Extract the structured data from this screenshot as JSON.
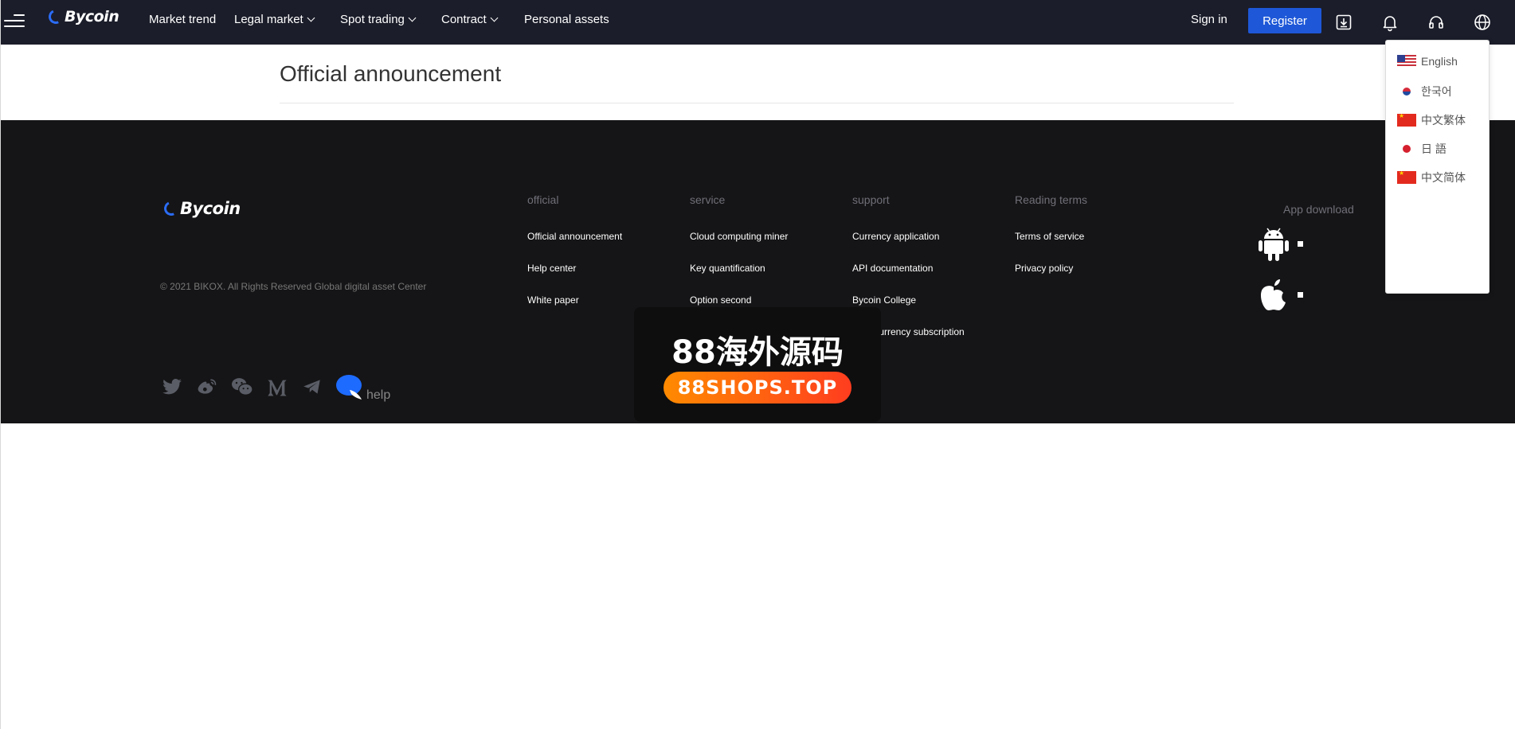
{
  "header": {
    "logo_text": "Bycoin",
    "nav": [
      {
        "label": "Market trend"
      },
      {
        "label": "Legal market"
      },
      {
        "label": "Spot trading"
      },
      {
        "label": "Contract"
      },
      {
        "label": "Personal assets"
      }
    ],
    "sign_in": "Sign in",
    "register": "Register",
    "icons": [
      "download-icon",
      "bell-icon",
      "headset-icon",
      "globe-icon"
    ]
  },
  "main": {
    "title": "Official announcement"
  },
  "footer": {
    "logo_text": "Bycoin",
    "copyright": "© 2021 BIKOX. All Rights Reserved Global digital asset Center",
    "columns": [
      {
        "heading": "official",
        "links": [
          "Official announcement",
          "Help center",
          "White paper"
        ]
      },
      {
        "heading": "service",
        "links": [
          "Cloud computing miner",
          "Key quantification",
          "Option second"
        ]
      },
      {
        "heading": "support",
        "links": [
          "Currency application",
          "API documentation",
          "Bycoin College",
          "New currency subscription"
        ]
      },
      {
        "heading": "Reading terms",
        "links": [
          "Terms of service",
          "Privacy policy"
        ]
      }
    ],
    "app_download": "App download",
    "social_icons": [
      "twitter-icon",
      "weibo-icon",
      "wechat-icon",
      "medium-icon",
      "telegram-icon"
    ],
    "help": "help"
  },
  "language_menu": {
    "items": [
      {
        "label": "English",
        "flag": "us"
      },
      {
        "label": "한국어",
        "flag": "kr"
      },
      {
        "label": "中文繁体",
        "flag": "cn"
      },
      {
        "label": "日 語",
        "flag": "jp"
      },
      {
        "label": "中文简体",
        "flag": "cn"
      }
    ]
  },
  "watermark": {
    "title": "88海外源码",
    "url": "88SHOPS.TOP"
  },
  "colors": {
    "nav_bg": "#1b1d2a",
    "footer_bg": "#151517",
    "accent": "#1e58d8",
    "help_bubble": "#1e6bff"
  }
}
